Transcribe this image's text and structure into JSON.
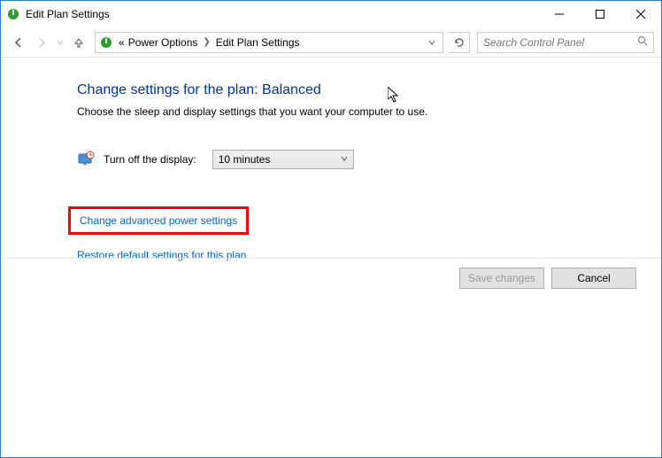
{
  "window": {
    "title": "Edit Plan Settings"
  },
  "breadcrumb": {
    "prefix": "«",
    "items": [
      "Power Options",
      "Edit Plan Settings"
    ]
  },
  "search": {
    "placeholder": "Search Control Panel"
  },
  "main": {
    "heading": "Change settings for the plan: Balanced",
    "subtext": "Choose the sleep and display settings that you want your computer to use.",
    "display_label": "Turn off the display:",
    "display_value": "10 minutes",
    "advanced_link": "Change advanced power settings",
    "restore_link": "Restore default settings for this plan"
  },
  "buttons": {
    "save": "Save changes",
    "cancel": "Cancel"
  }
}
